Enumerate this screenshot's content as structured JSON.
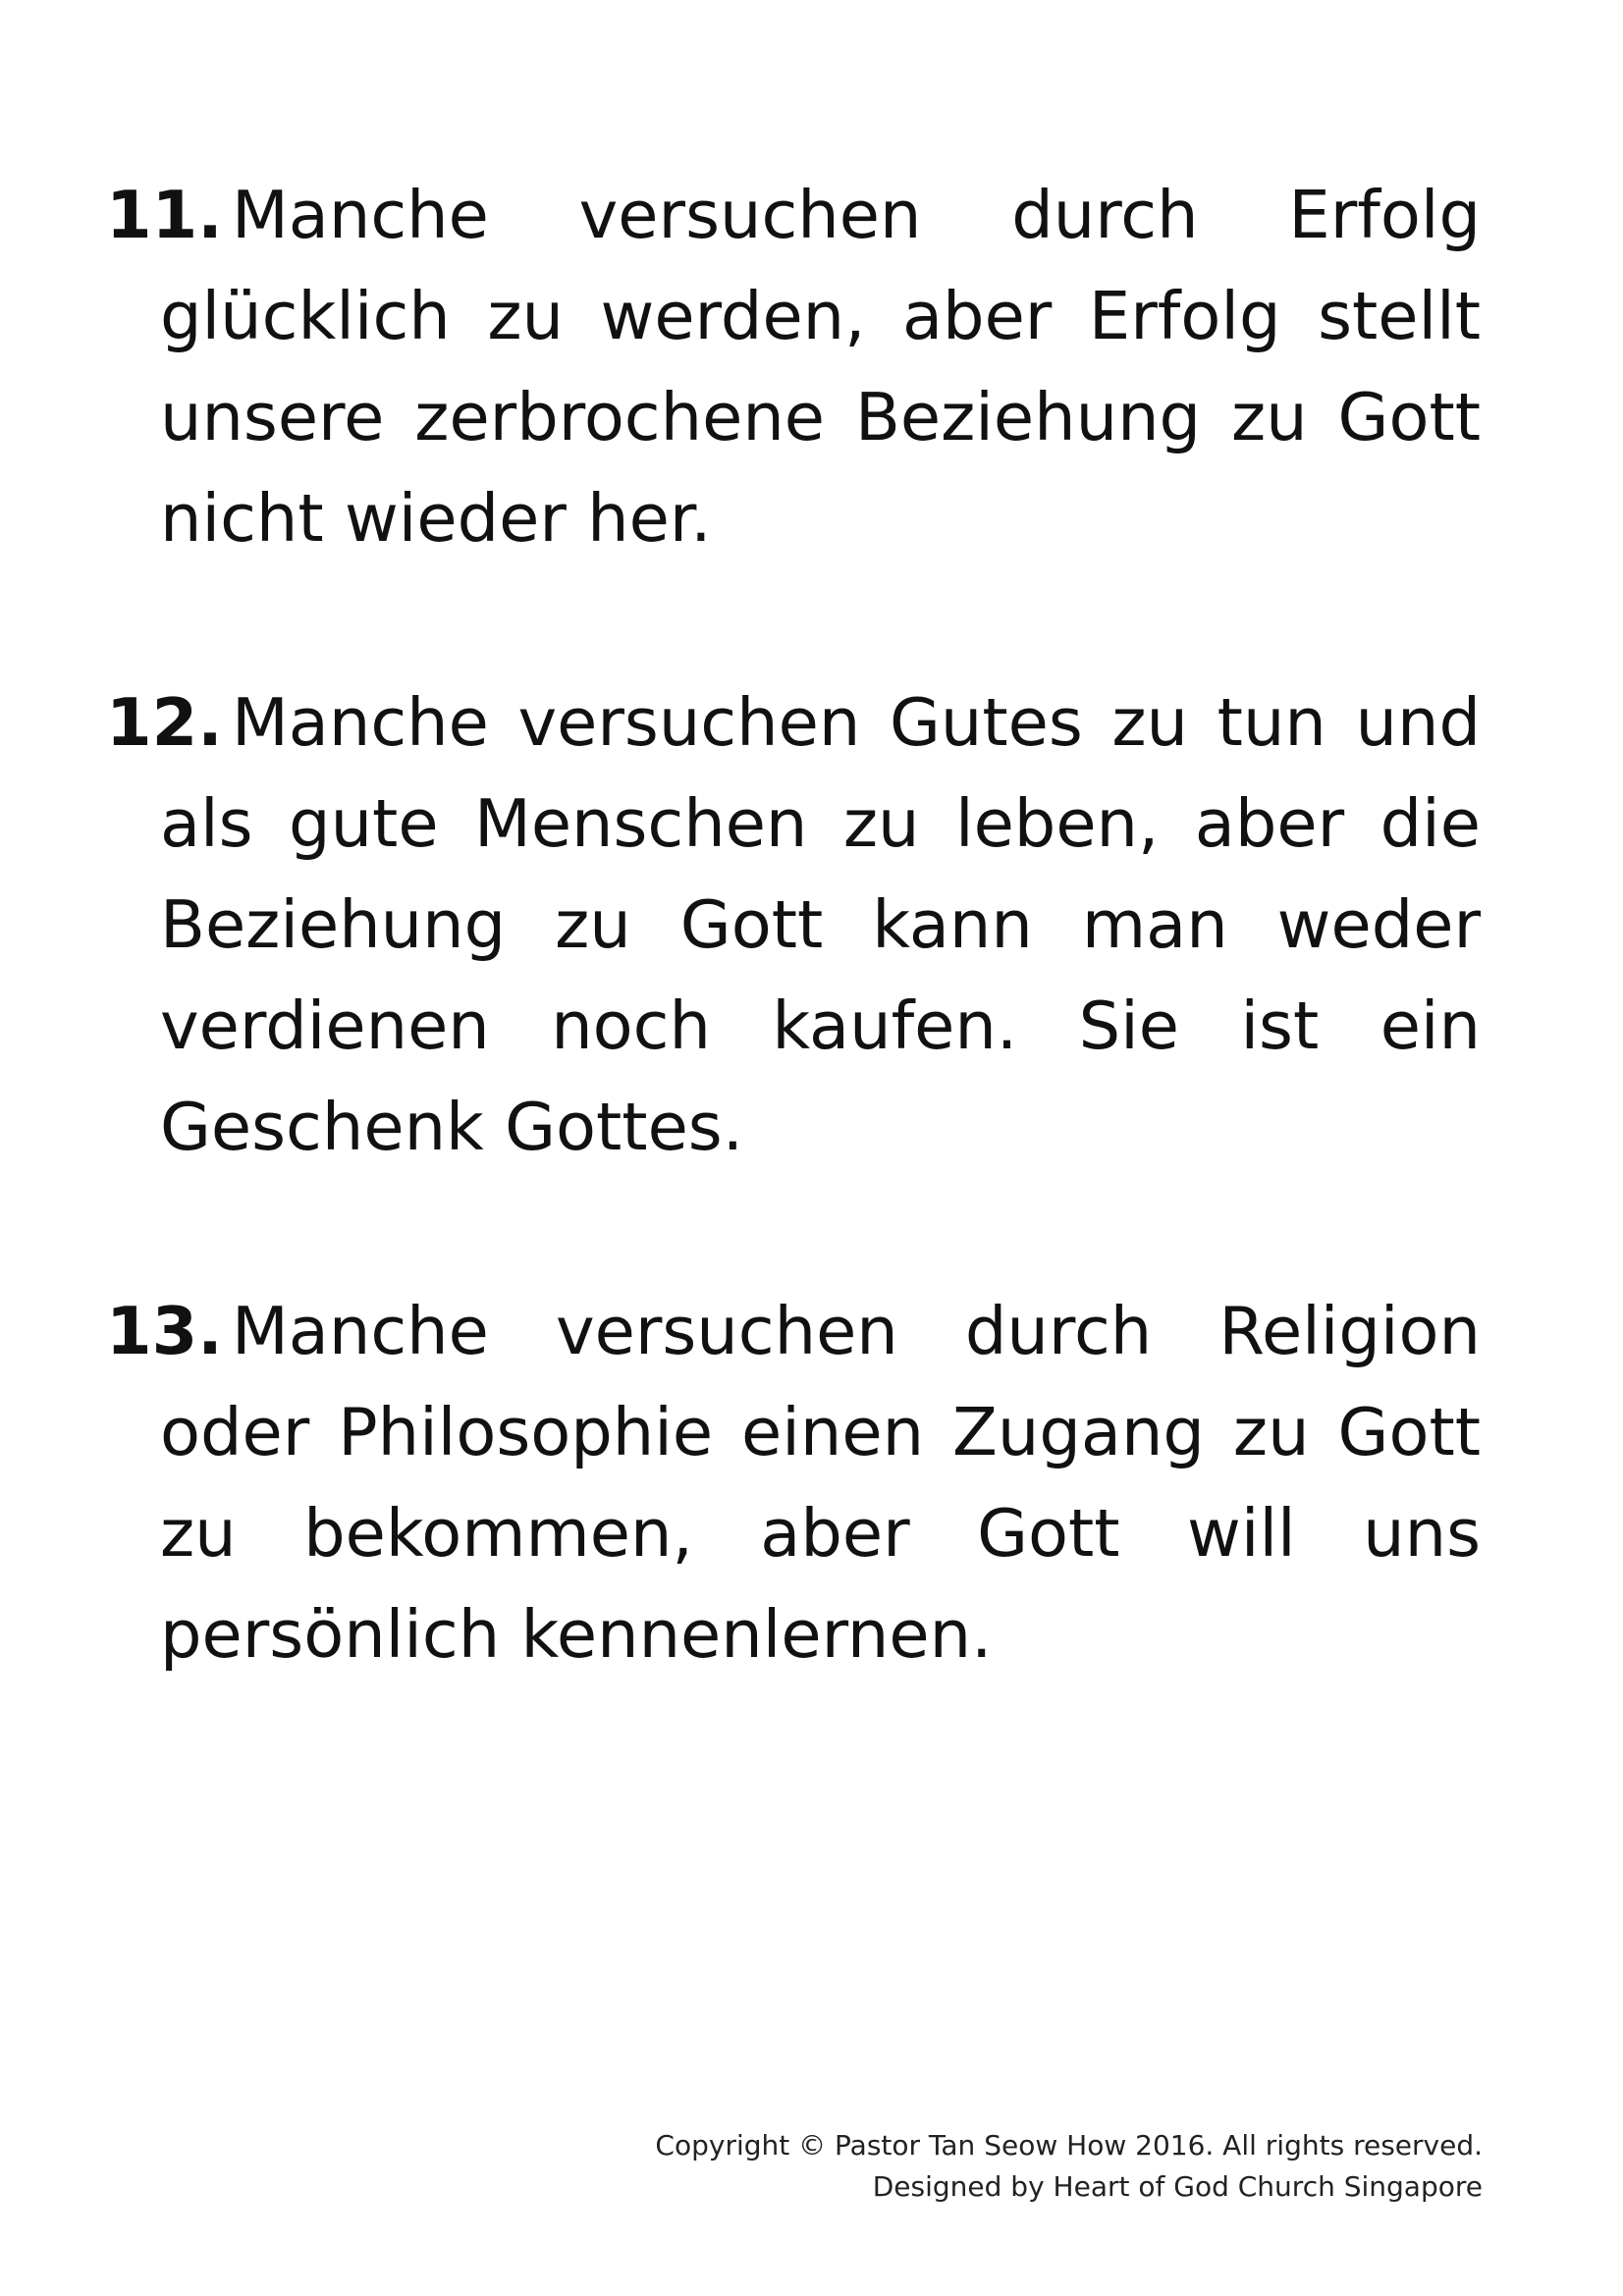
{
  "items": [
    {
      "number": "11.",
      "text": "Manche versuchen durch Erfolg glücklich zu werden, aber Erfolg stellt unsere zerbrochene Beziehung zu Gott nicht wieder her."
    },
    {
      "number": "12.",
      "text": "Manche versuchen Gutes zu tun und als gute Menschen zu leben, aber die Beziehung zu Gott kann man weder verdienen noch kaufen. Sie ist ein Geschenk Gottes."
    },
    {
      "number": "13.",
      "text": "Manche versuchen durch Religion oder Philosophie einen Zugang zu Gott zu bekommen, aber Gott will uns persönlich kennenlernen."
    }
  ],
  "footer": {
    "copyright": "Copyright © Pastor Tan Seow How 2016. All rights reserved.",
    "designed_by": "Designed by Heart of God Church Singapore"
  }
}
